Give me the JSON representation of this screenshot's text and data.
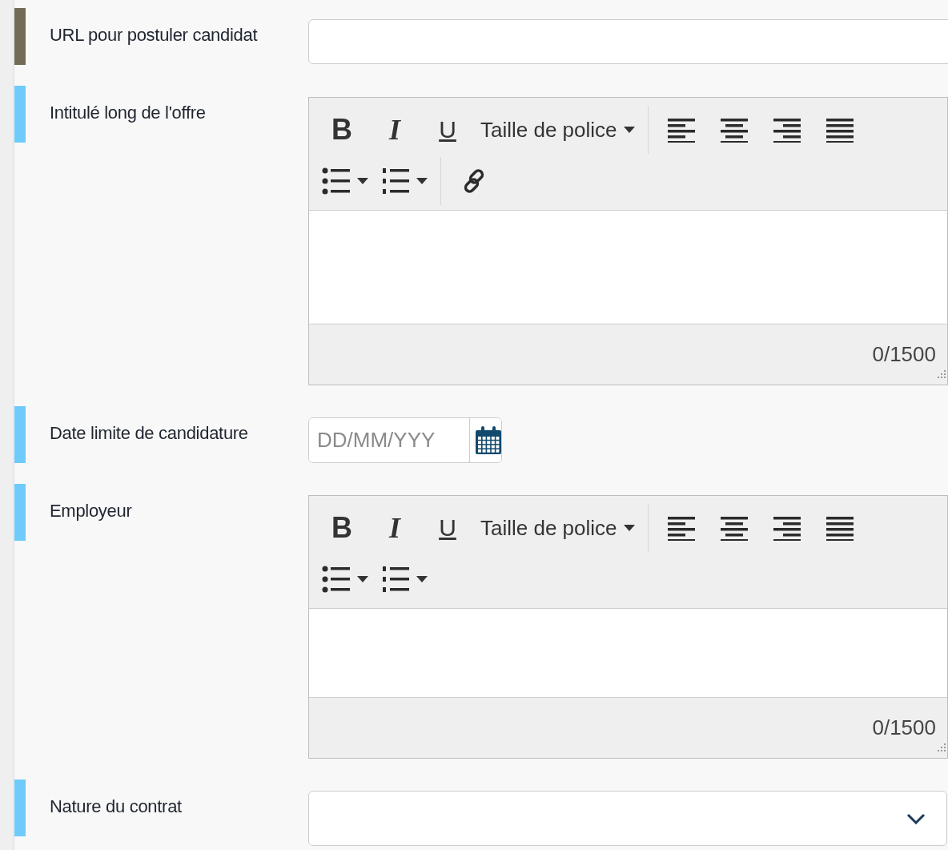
{
  "fields": [
    {
      "label": "URL pour postuler candidat",
      "kind": "text",
      "color": "#726b56"
    },
    {
      "label": "Intitulé long de l'offre",
      "kind": "richtext",
      "color": "#6fcbfc",
      "counter": "0/1500",
      "toolbar": [
        [
          {
            "items": [
              {
                "kind": "bold",
                "text": "B"
              },
              {
                "kind": "italic",
                "text": "I"
              },
              {
                "kind": "underline",
                "text": "U"
              },
              {
                "kind": "dropdown",
                "text": "Taille de police"
              }
            ]
          },
          {
            "items": [
              {
                "kind": "align-left"
              },
              {
                "kind": "align-center"
              },
              {
                "kind": "align-right"
              },
              {
                "kind": "align-justify"
              }
            ]
          }
        ],
        [
          {
            "items": [
              {
                "kind": "bullet-list"
              },
              {
                "kind": "numbered-list"
              }
            ]
          },
          {
            "items": [
              {
                "kind": "link"
              }
            ]
          }
        ]
      ]
    },
    {
      "label": "Date limite de candidature",
      "kind": "date",
      "color": "#6fcbfc",
      "placeholder": "DD/MM/YYY"
    },
    {
      "label": "Employeur",
      "kind": "richtext",
      "color": "#6fcbfc",
      "counter": "0/1500",
      "toolbar": [
        [
          {
            "items": [
              {
                "kind": "bold",
                "text": "B"
              },
              {
                "kind": "italic",
                "text": "I"
              },
              {
                "kind": "underline",
                "text": "U"
              },
              {
                "kind": "dropdown",
                "text": "Taille de police"
              }
            ]
          },
          {
            "items": [
              {
                "kind": "align-left"
              },
              {
                "kind": "align-center"
              },
              {
                "kind": "align-right"
              },
              {
                "kind": "align-justify"
              }
            ]
          }
        ],
        [
          {
            "items": [
              {
                "kind": "bullet-list"
              },
              {
                "kind": "numbered-list"
              }
            ]
          }
        ]
      ]
    },
    {
      "label": "Nature du contrat",
      "kind": "select",
      "color": "#6fcbfc"
    }
  ]
}
